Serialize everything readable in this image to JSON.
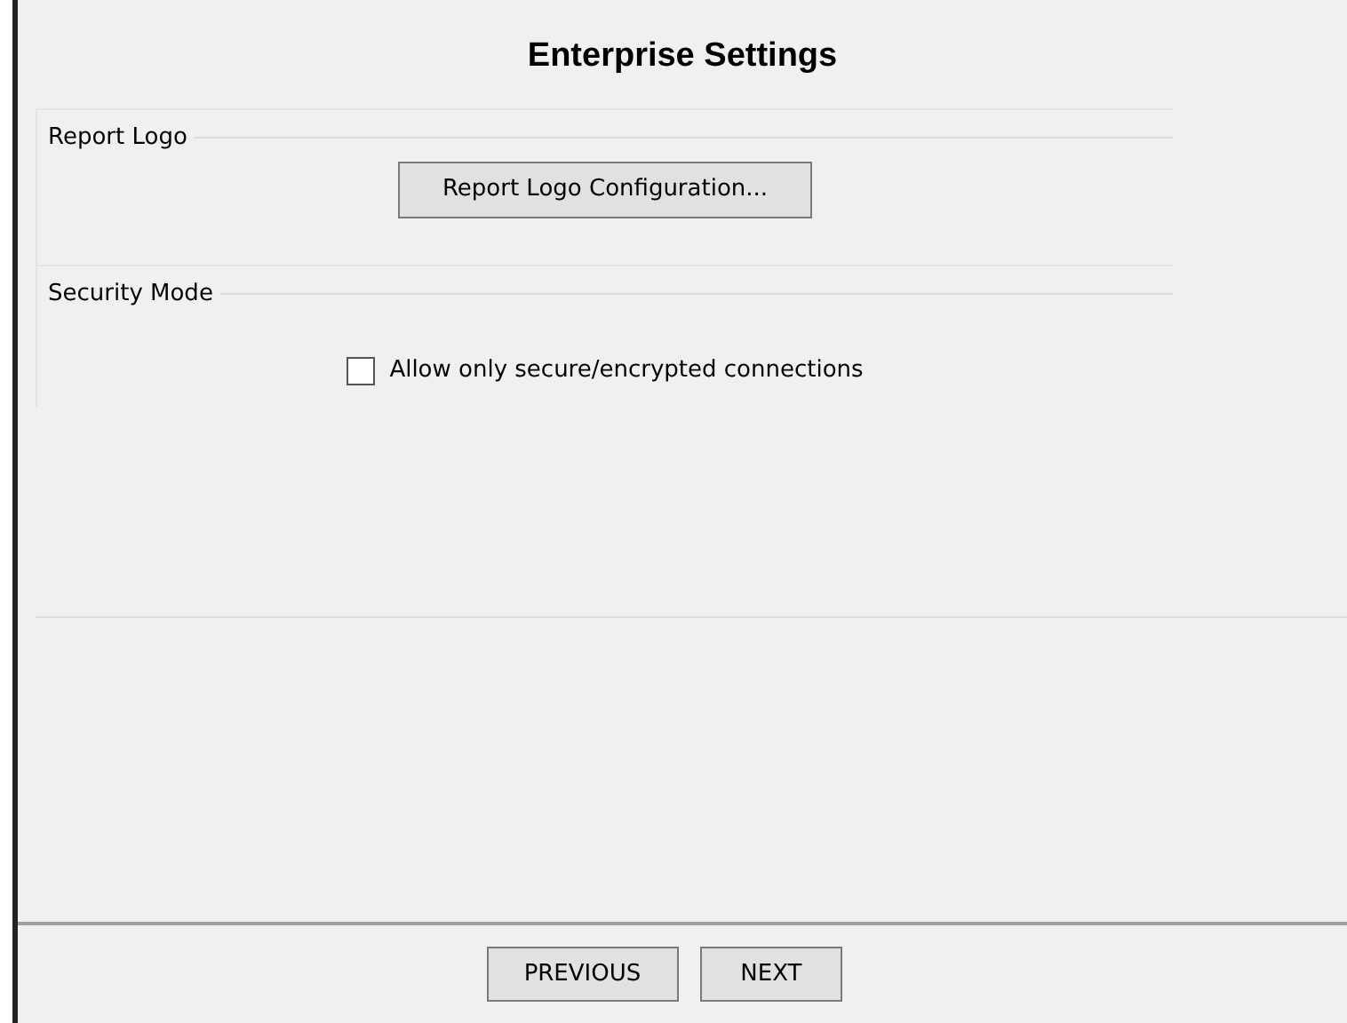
{
  "window": {
    "title": "Enterprise Settings"
  },
  "groups": [
    {
      "title": "Report Logo",
      "kind": "button",
      "label": "Report Logo Configuration..."
    },
    {
      "title": "Security Mode",
      "kind": "checkbox",
      "label": "Allow only secure/encrypted connections",
      "checked": false
    }
  ],
  "buttons": [
    "PREVIOUS",
    "NEXT"
  ]
}
